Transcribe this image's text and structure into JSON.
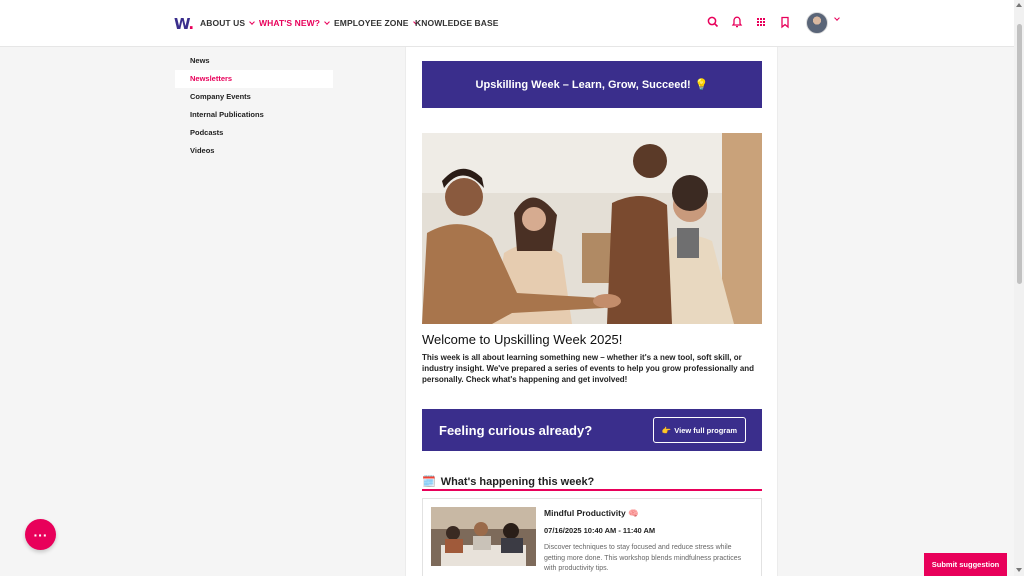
{
  "brand": {
    "logo_text": "W",
    "logo_dot": ".",
    "primary": "#3a2e8c",
    "accent": "#e8005a"
  },
  "nav": {
    "items": [
      {
        "label": "ABOUT US"
      },
      {
        "label": "WHAT'S NEW?"
      },
      {
        "label": "EMPLOYEE ZONE"
      },
      {
        "label": "KNOWLEDGE BASE"
      }
    ],
    "icons": [
      "search-icon",
      "bell-icon",
      "apps-grid-icon",
      "bookmark-icon",
      "avatar"
    ]
  },
  "sidebar": {
    "items": [
      {
        "label": "News"
      },
      {
        "label": "Newsletters"
      },
      {
        "label": "Company Events"
      },
      {
        "label": "Internal Publications"
      },
      {
        "label": "Podcasts"
      },
      {
        "label": "Videos"
      }
    ]
  },
  "main": {
    "banner_title": "Upskilling Week – Learn, Grow, Succeed!",
    "banner_emoji": "💡",
    "welcome_title": "Welcome to Upskilling Week 2025!",
    "welcome_body": "This week is all about learning something new – whether it's a new tool, soft skill, or industry insight. We've prepared a series of events to help you grow professionally and personally. Check what's happening and get involved!",
    "cta_text": "Feeling curious already?",
    "cta_button_emoji": "👉",
    "cta_button": "View full program",
    "section_emoji": "🗓️",
    "section_title": "What's happening this week?",
    "events": [
      {
        "title": "Mindful Productivity",
        "emoji": "🧠",
        "datetime": "07/16/2025 10:40 AM - 11:40 AM",
        "description": "Discover techniques to stay focused and reduce stress while getting more done. This workshop blends mindfulness practices with productivity tips."
      }
    ]
  },
  "floating": {
    "fab_label": "···",
    "suggest_label": "Submit suggestion"
  }
}
